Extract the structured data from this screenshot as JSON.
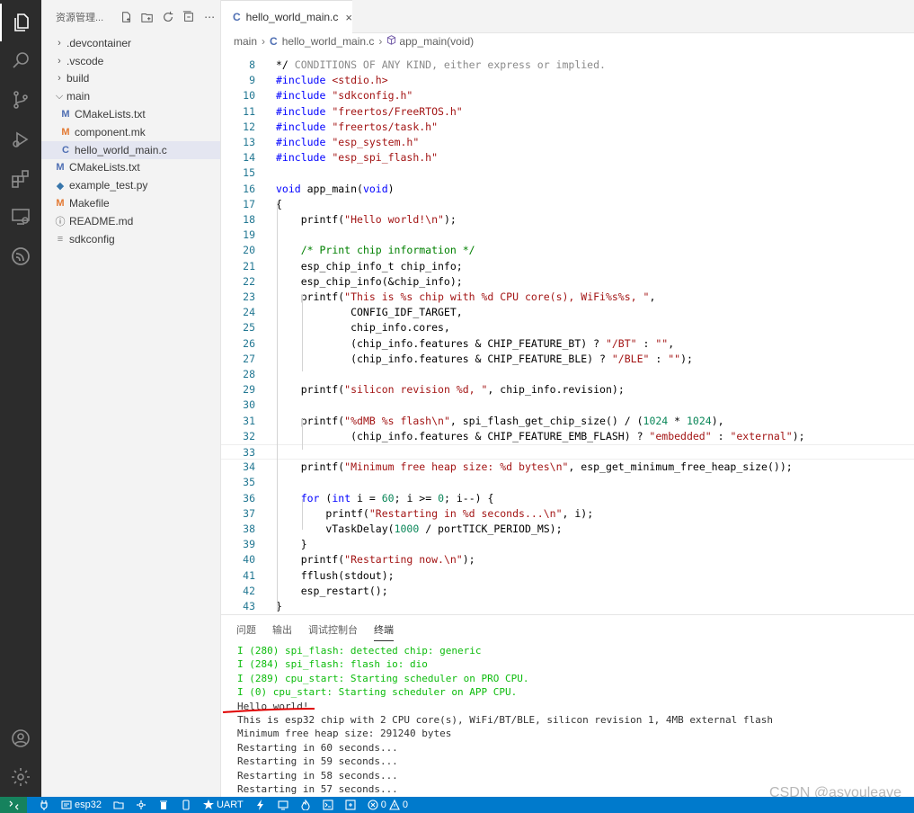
{
  "sidebar": {
    "title": "资源管理...",
    "items": [
      {
        "label": ".devcontainer",
        "kind": "folder-collapsed",
        "depth": 1
      },
      {
        "label": ".vscode",
        "kind": "folder-collapsed",
        "depth": 1
      },
      {
        "label": "build",
        "kind": "folder-collapsed",
        "depth": 1
      },
      {
        "label": "main",
        "kind": "folder-expanded",
        "depth": 1
      },
      {
        "label": "CMakeLists.txt",
        "kind": "cmake",
        "depth": 2
      },
      {
        "label": "component.mk",
        "kind": "mk",
        "depth": 2
      },
      {
        "label": "hello_world_main.c",
        "kind": "c",
        "depth": 2,
        "selected": true
      },
      {
        "label": "CMakeLists.txt",
        "kind": "cmake",
        "depth": 1
      },
      {
        "label": "example_test.py",
        "kind": "py",
        "depth": 1
      },
      {
        "label": "Makefile",
        "kind": "mk",
        "depth": 1
      },
      {
        "label": "README.md",
        "kind": "info",
        "depth": 1
      },
      {
        "label": "sdkconfig",
        "kind": "lines",
        "depth": 1
      }
    ]
  },
  "tab": {
    "label": "hello_world_main.c",
    "icon": "C",
    "close": "×"
  },
  "breadcrumb": {
    "folder": "main",
    "file": "hello_world_main.c",
    "symbol": "app_main(void)"
  },
  "editor": {
    "partial_top": "   CONDITIONS OF ANY KIND, either express or implied.",
    "lines": [
      {
        "n": "8",
        "segs": [
          [
            "",
            "*/"
          ]
        ]
      },
      {
        "n": "9",
        "segs": [
          [
            "pre",
            "#include"
          ],
          [
            "",
            " "
          ],
          [
            "str",
            "<stdio.h>"
          ]
        ]
      },
      {
        "n": "10",
        "segs": [
          [
            "pre",
            "#include"
          ],
          [
            "",
            " "
          ],
          [
            "str",
            "\"sdkconfig.h\""
          ]
        ]
      },
      {
        "n": "11",
        "segs": [
          [
            "pre",
            "#include"
          ],
          [
            "",
            " "
          ],
          [
            "str",
            "\"freertos/FreeRTOS.h\""
          ]
        ]
      },
      {
        "n": "12",
        "segs": [
          [
            "pre",
            "#include"
          ],
          [
            "",
            " "
          ],
          [
            "str",
            "\"freertos/task.h\""
          ]
        ]
      },
      {
        "n": "13",
        "segs": [
          [
            "pre",
            "#include"
          ],
          [
            "",
            " "
          ],
          [
            "str",
            "\"esp_system.h\""
          ]
        ]
      },
      {
        "n": "14",
        "segs": [
          [
            "pre",
            "#include"
          ],
          [
            "",
            " "
          ],
          [
            "str",
            "\"esp_spi_flash.h\""
          ]
        ]
      },
      {
        "n": "15",
        "segs": []
      },
      {
        "n": "16",
        "segs": [
          [
            "kw",
            "void"
          ],
          [
            "",
            " app_main("
          ],
          [
            "kw",
            "void"
          ],
          [
            "",
            ")"
          ]
        ]
      },
      {
        "n": "17",
        "segs": [
          [
            "",
            "{"
          ]
        ]
      },
      {
        "n": "18",
        "segs": [
          [
            "",
            "    printf("
          ],
          [
            "str",
            "\"Hello world!\\n\""
          ],
          [
            "",
            ");"
          ]
        ]
      },
      {
        "n": "19",
        "segs": []
      },
      {
        "n": "20",
        "segs": [
          [
            "",
            "    "
          ],
          [
            "cm",
            "/* Print chip information */"
          ]
        ]
      },
      {
        "n": "21",
        "segs": [
          [
            "",
            "    esp_chip_info_t chip_info;"
          ]
        ]
      },
      {
        "n": "22",
        "segs": [
          [
            "",
            "    esp_chip_info(&chip_info);"
          ]
        ]
      },
      {
        "n": "23",
        "segs": [
          [
            "",
            "    printf("
          ],
          [
            "str",
            "\"This is %s chip with %d CPU core(s), WiFi%s%s, \""
          ],
          [
            "",
            ","
          ]
        ]
      },
      {
        "n": "24",
        "segs": [
          [
            "",
            "            CONFIG_IDF_TARGET,"
          ]
        ]
      },
      {
        "n": "25",
        "segs": [
          [
            "",
            "            chip_info.cores,"
          ]
        ]
      },
      {
        "n": "26",
        "segs": [
          [
            "",
            "            (chip_info.features & CHIP_FEATURE_BT) ? "
          ],
          [
            "str",
            "\"/BT\""
          ],
          [
            "",
            " : "
          ],
          [
            "str",
            "\"\""
          ],
          [
            "",
            ","
          ]
        ]
      },
      {
        "n": "27",
        "segs": [
          [
            "",
            "            (chip_info.features & CHIP_FEATURE_BLE) ? "
          ],
          [
            "str",
            "\"/BLE\""
          ],
          [
            "",
            " : "
          ],
          [
            "str",
            "\"\""
          ],
          [
            "",
            ");"
          ]
        ]
      },
      {
        "n": "28",
        "segs": []
      },
      {
        "n": "29",
        "segs": [
          [
            "",
            "    printf("
          ],
          [
            "str",
            "\"silicon revision %d, \""
          ],
          [
            "",
            ", chip_info.revision);"
          ]
        ]
      },
      {
        "n": "30",
        "segs": []
      },
      {
        "n": "31",
        "segs": [
          [
            "",
            "    printf("
          ],
          [
            "str",
            "\"%dMB %s flash\\n\""
          ],
          [
            "",
            ", spi_flash_get_chip_size() / ("
          ],
          [
            "num",
            "1024"
          ],
          [
            "",
            " * "
          ],
          [
            "num",
            "1024"
          ],
          [
            "",
            "),"
          ]
        ]
      },
      {
        "n": "32",
        "segs": [
          [
            "",
            "            (chip_info.features & CHIP_FEATURE_EMB_FLASH) ? "
          ],
          [
            "str",
            "\"embedded\""
          ],
          [
            "",
            " : "
          ],
          [
            "str",
            "\"external\""
          ],
          [
            "",
            ");"
          ]
        ]
      },
      {
        "n": "33",
        "segs": []
      },
      {
        "n": "34",
        "segs": [
          [
            "",
            "    printf("
          ],
          [
            "str",
            "\"Minimum free heap size: %d bytes\\n\""
          ],
          [
            "",
            ", esp_get_minimum_free_heap_size());"
          ]
        ]
      },
      {
        "n": "35",
        "segs": []
      },
      {
        "n": "36",
        "segs": [
          [
            "",
            "    "
          ],
          [
            "kw",
            "for"
          ],
          [
            "",
            " ("
          ],
          [
            "kw",
            "int"
          ],
          [
            "",
            " i = "
          ],
          [
            "num",
            "60"
          ],
          [
            "",
            "; i >= "
          ],
          [
            "num",
            "0"
          ],
          [
            "",
            "; i--) {"
          ]
        ]
      },
      {
        "n": "37",
        "segs": [
          [
            "",
            "        printf("
          ],
          [
            "str",
            "\"Restarting in %d seconds...\\n\""
          ],
          [
            "",
            ", i);"
          ]
        ]
      },
      {
        "n": "38",
        "segs": [
          [
            "",
            "        vTaskDelay("
          ],
          [
            "num",
            "1000"
          ],
          [
            "",
            " / portTICK_PERIOD_MS);"
          ]
        ]
      },
      {
        "n": "39",
        "segs": [
          [
            "",
            "    }"
          ]
        ]
      },
      {
        "n": "40",
        "segs": [
          [
            "",
            "    printf("
          ],
          [
            "str",
            "\"Restarting now.\\n\""
          ],
          [
            "",
            ");"
          ]
        ]
      },
      {
        "n": "41",
        "segs": [
          [
            "",
            "    fflush(stdout);"
          ]
        ]
      },
      {
        "n": "42",
        "segs": [
          [
            "",
            "    esp_restart();"
          ]
        ]
      },
      {
        "n": "43",
        "segs": [
          [
            "",
            "}"
          ]
        ]
      }
    ]
  },
  "panel": {
    "tabs": [
      "问题",
      "输出",
      "调试控制台",
      "终端"
    ],
    "active_tab": "终端",
    "terminal": [
      {
        "text": "I (280) spi_flash: detected chip: generic",
        "green": true
      },
      {
        "text": "I (284) spi_flash: flash io: dio",
        "green": true
      },
      {
        "text": "I (289) cpu_start: Starting scheduler on PRO CPU.",
        "green": true
      },
      {
        "text": "I (0) cpu_start: Starting scheduler on APP CPU.",
        "green": true
      },
      {
        "text": "Hello world!",
        "green": false
      },
      {
        "text": "This is esp32 chip with 2 CPU core(s), WiFi/BT/BLE, silicon revision 1, 4MB external flash",
        "green": false
      },
      {
        "text": "Minimum free heap size: 291240 bytes",
        "green": false
      },
      {
        "text": "Restarting in 60 seconds...",
        "green": false
      },
      {
        "text": "Restarting in 59 seconds...",
        "green": false
      },
      {
        "text": "Restarting in 58 seconds...",
        "green": false
      },
      {
        "text": "Restarting in 57 seconds...",
        "green": false
      }
    ]
  },
  "watermark": "CSDN @asyouleave",
  "statusbar": {
    "remote_icon": "remote-icon",
    "target": "esp32",
    "uart": "UART",
    "problems": "0",
    "warnings": "0"
  },
  "colors": {
    "activity_bar": "#2c2c2c",
    "status_bar": "#007acc",
    "remote": "#16825d",
    "terminal_green": "#0dbc0d",
    "underline_red": "#e00000"
  }
}
